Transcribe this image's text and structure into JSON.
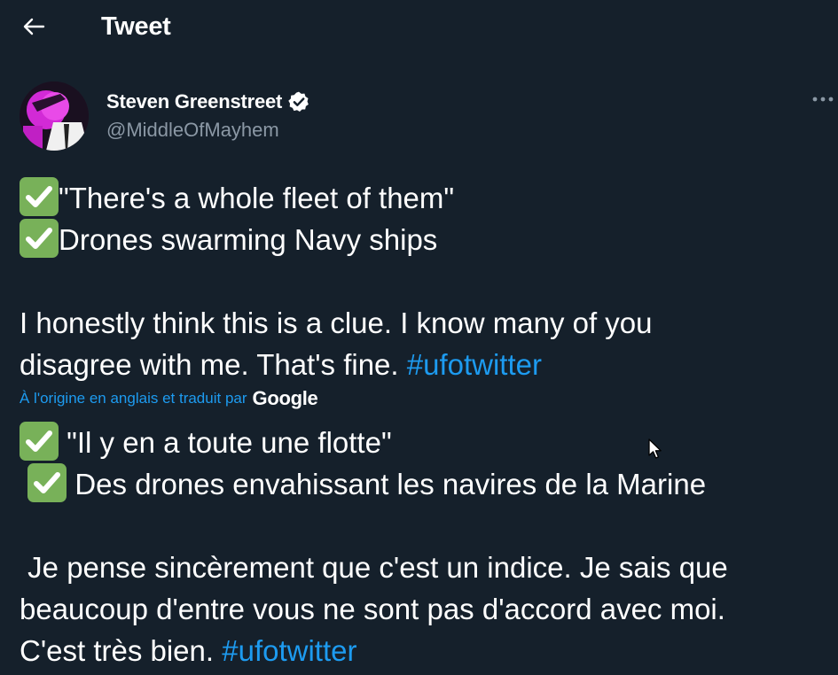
{
  "header": {
    "title": "Tweet",
    "back_icon": "arrow-left-icon"
  },
  "author": {
    "name": "Steven Greenstreet",
    "handle": "@MiddleOfMayhem",
    "verified": true,
    "avatar_icon": "avatar-image"
  },
  "tweet": {
    "original": {
      "line1": "\"There's a whole fleet of them\"",
      "line2": "Drones swarming Navy ships",
      "line3": "I honestly think this is a clue. I know many of you",
      "line4": "disagree with me. That's fine. ",
      "hashtag": "#ufotwitter"
    },
    "translation_attribution": "À l'origine en anglais et traduit par",
    "translation_provider": "Google",
    "translated": {
      "line1": " \"Il y en a toute une flotte\"",
      "line2": " Des drones envahissant les navires de la Marine",
      "line3": " Je pense sincèrement que c'est un indice. Je sais que",
      "line4": "beaucoup d'entre vous ne sont pas d'accord avec moi.",
      "line5": "C'est très bien. ",
      "hashtag": "#ufotwitter"
    }
  },
  "colors": {
    "background": "#15202b",
    "text": "#ffffff",
    "secondary_text": "#8b98a5",
    "link": "#1d9bf0",
    "check_emoji": "#78b159"
  }
}
